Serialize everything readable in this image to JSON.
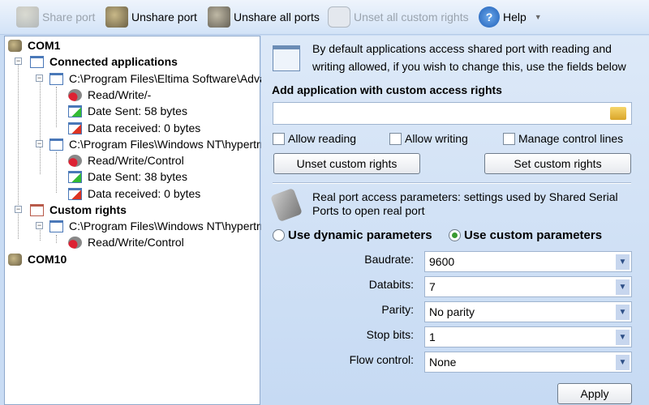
{
  "toolbar": {
    "share": "Share port",
    "unshare": "Unshare port",
    "unshare_all": "Unshare all ports",
    "unset_all": "Unset all custom rights",
    "help": "Help"
  },
  "tree": {
    "com1": "COM1",
    "connected": "Connected applications",
    "app1": {
      "path": "C:\\Program Files\\Eltima Software\\Adva",
      "rights": "Read/Write/-",
      "sent": "Date Sent: 58 bytes",
      "recv": "Data received: 0 bytes"
    },
    "app2": {
      "path": "C:\\Program Files\\Windows NT\\hypertrm",
      "rights": "Read/Write/Control",
      "sent": "Date Sent: 38 bytes",
      "recv": "Data received: 0 bytes"
    },
    "custom": "Custom rights",
    "app3": {
      "path": "C:\\Program Files\\Windows NT\\hypertrm",
      "rights": "Read/Write/Control"
    },
    "com10": "COM10"
  },
  "panel": {
    "info_line1": "By default applications access shared port with reading and",
    "info_line2": "writing allowed, if you wish to change this, use the fields below",
    "add_heading": "Add application with custom access rights",
    "app_input": "",
    "allow_reading": "Allow reading",
    "allow_writing": "Allow writing",
    "manage_lines": "Manage control lines",
    "unset_btn": "Unset custom rights",
    "set_btn": "Set custom rights",
    "real_line1": "Real port access parameters: settings used by Shared Serial",
    "real_line2": "Ports to open real port",
    "dynamic": "Use dynamic parameters",
    "custom": "Use custom parameters",
    "fields": [
      {
        "label": "Baudrate:",
        "value": "9600"
      },
      {
        "label": "Databits:",
        "value": "7"
      },
      {
        "label": "Parity:",
        "value": "No parity"
      },
      {
        "label": "Stop bits:",
        "value": "1"
      },
      {
        "label": "Flow control:",
        "value": "None"
      }
    ],
    "apply": "Apply"
  }
}
